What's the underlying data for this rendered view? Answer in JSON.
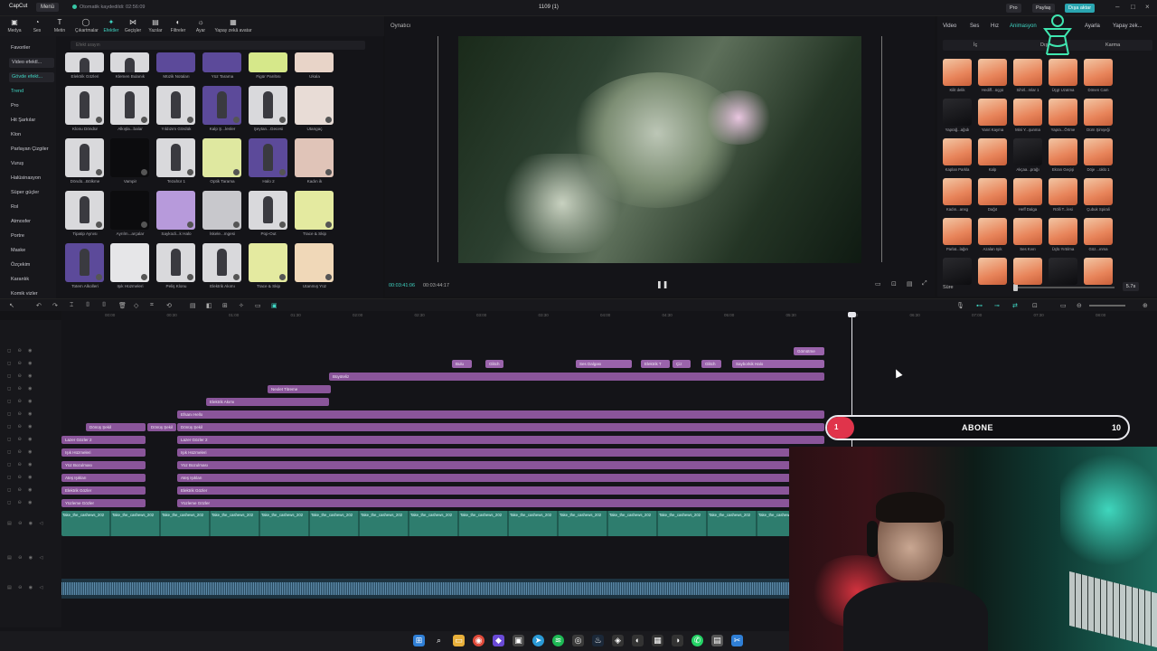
{
  "titlebar": {
    "logo": "CapCut",
    "menu": "Menü",
    "autosave": "Otomatik kaydedildi: 02:56:09",
    "project_title": "1109 (1)",
    "pro": "Pro",
    "share": "Paylaş",
    "export": "Dışa aktar"
  },
  "tools": [
    {
      "label": "Medya",
      "icon": "media-icon"
    },
    {
      "label": "Ses",
      "icon": "audio-icon"
    },
    {
      "label": "Metin",
      "icon": "text-icon"
    },
    {
      "label": "Çıkartmalar",
      "icon": "sticker-icon"
    },
    {
      "label": "Efektler",
      "icon": "effects-icon"
    },
    {
      "label": "Geçişler",
      "icon": "transition-icon"
    },
    {
      "label": "Yazılar",
      "icon": "captions-icon"
    },
    {
      "label": "Filtreler",
      "icon": "filter-icon"
    },
    {
      "label": "Ayar",
      "icon": "adjust-icon"
    },
    {
      "label": "Yapay zekâ avatar",
      "icon": "avatar-icon"
    }
  ],
  "sidebar": {
    "favorites": "Favoriler",
    "video_effects": "Video efektl...",
    "body_effects": "Gövde efekt...",
    "items": [
      "Trend",
      "Pro",
      "Hit Şarkılar",
      "Klon",
      "Parlayan Çizgiler",
      "Vuruş",
      "Halüsinasyon",
      "Süper güçler",
      "Rol",
      "Atmosfer",
      "Portre",
      "Maske",
      "Özçekim",
      "Karanlık",
      "Komik vizler"
    ]
  },
  "media": {
    "search_placeholder": "Efekt arayın",
    "row0": [
      "Elektrik Gözleri",
      "Klemen Bulanık",
      "Müzik Notaları",
      "Yüz Tarama",
      "Figür Parıltısı",
      "Ukala"
    ],
    "row1": [
      "Klonu Döndür",
      "Alkışla...balar",
      "Yıldızım Gördük",
      "Kalp Ş...lenler",
      "Şeytan...Gecesi",
      "Utangaç"
    ],
    "row2": [
      "Döndü...Bölkme",
      "Vampir",
      "Tezahür 1",
      "Optik Tarama",
      "Halo 2",
      "Kadın ik"
    ],
    "row3": [
      "Tipatip Aynısı",
      "Ayrılm...arçalar",
      "Saykodi...k Halo",
      "İskele...mgesi",
      "Pop-Out",
      "Trace & Skip"
    ],
    "row4": [
      "Totem Alkolleri",
      "Işık Hüzmeleri",
      "Peliş Klonu",
      "Elektrik Akımı",
      "Trace & Skip",
      "Utanmış Yüz"
    ]
  },
  "player": {
    "title": "Oynatıcı",
    "current_time": "00:03:41:06",
    "total_time": "00:03:44:17"
  },
  "props": {
    "tabs": [
      "Video",
      "Ses",
      "Hız",
      "Animasyon",
      "Ayarla",
      "Yapay zek..."
    ],
    "active_tab": "Animasyon",
    "subtabs": [
      "İç",
      "Dış",
      "Karma"
    ],
    "anim_rows": [
      [
        "Kilit delik",
        "Hediff...üçgü",
        "Sihirl...mlar 1",
        "Üçgt Uzatma",
        "Dönen Cam"
      ],
      [
        "Yaprağ...ağıdı",
        "Yanıt Kayma",
        "Mini Y...şunma",
        "Yapra...Örtme",
        "Dürn Şimşeği"
      ],
      [
        "Kaplan Parkla",
        "Kalp",
        "Akçaa...prağı",
        "Ekran Geçişi",
        "Döje ...üklü 1"
      ],
      [
        "Kadın...ansg",
        "Dağıt",
        "Heff Dalga",
        "Rölli T...lesi",
        "Çubuk Spirali"
      ],
      [
        "Parlat...lağırı",
        "Azalan Işık",
        "Ses Kıvrı",
        "Üçlü Yırtılma",
        "Göz...ınma"
      ],
      [
        "",
        "",
        "",
        "",
        ""
      ]
    ],
    "duration_label": "Süre",
    "duration_value": "5.7s"
  },
  "ruler": [
    "00:00",
    "00:30",
    "01:00",
    "01:30",
    "02:00",
    "02:30",
    "03:00",
    "03:30",
    "04:00",
    "04:30",
    "05:00",
    "05:30",
    "06:00",
    "06:30",
    "07:00",
    "07:30",
    "08:00",
    "08:30"
  ],
  "clips": {
    "c1": "Gömütme",
    "c2": "Bulu",
    "c3": "Glitch",
    "c4": "Ses Dalgası",
    "c5": "Elektrik T",
    "c6": "Çiz",
    "c7": "Glitch",
    "c8": "Sayborkik Halo",
    "c9": "Büyüteliz",
    "c10": "Neolet Titreme",
    "c11": "Elektrik Akımı",
    "c12": "Efsanı Hello",
    "c13": "Dönüş Şekil",
    "c14": "Dönüş Şekil",
    "c15": "Dönüş Şekil",
    "c16": "Lazer Gözler 2",
    "c17": "Lazer Gözler 2",
    "c18": "Işık Hüzmeleri",
    "c19": "Işık Hüzmeleri",
    "c20": "Yüz Bozulması",
    "c21": "Yüz Bozulması",
    "c22": "Ateş Işıkları",
    "c23": "Ateş Işıkları",
    "c24": "Elektrik Gözler",
    "c25": "Elektrik Gözler",
    "c26": "Yüzleme Gözler",
    "c27": "Yüzleme Gözler"
  },
  "video_clip_label": "Take_the_cashews_202",
  "overlay": {
    "count_left": "1",
    "text": "ABONE",
    "count_right": "10"
  },
  "colors": {
    "accent": "#3fd4c2",
    "clip_effect": "#8a559a",
    "clip_video": "#2e7d6e",
    "subscribe_red": "#e0344b"
  }
}
